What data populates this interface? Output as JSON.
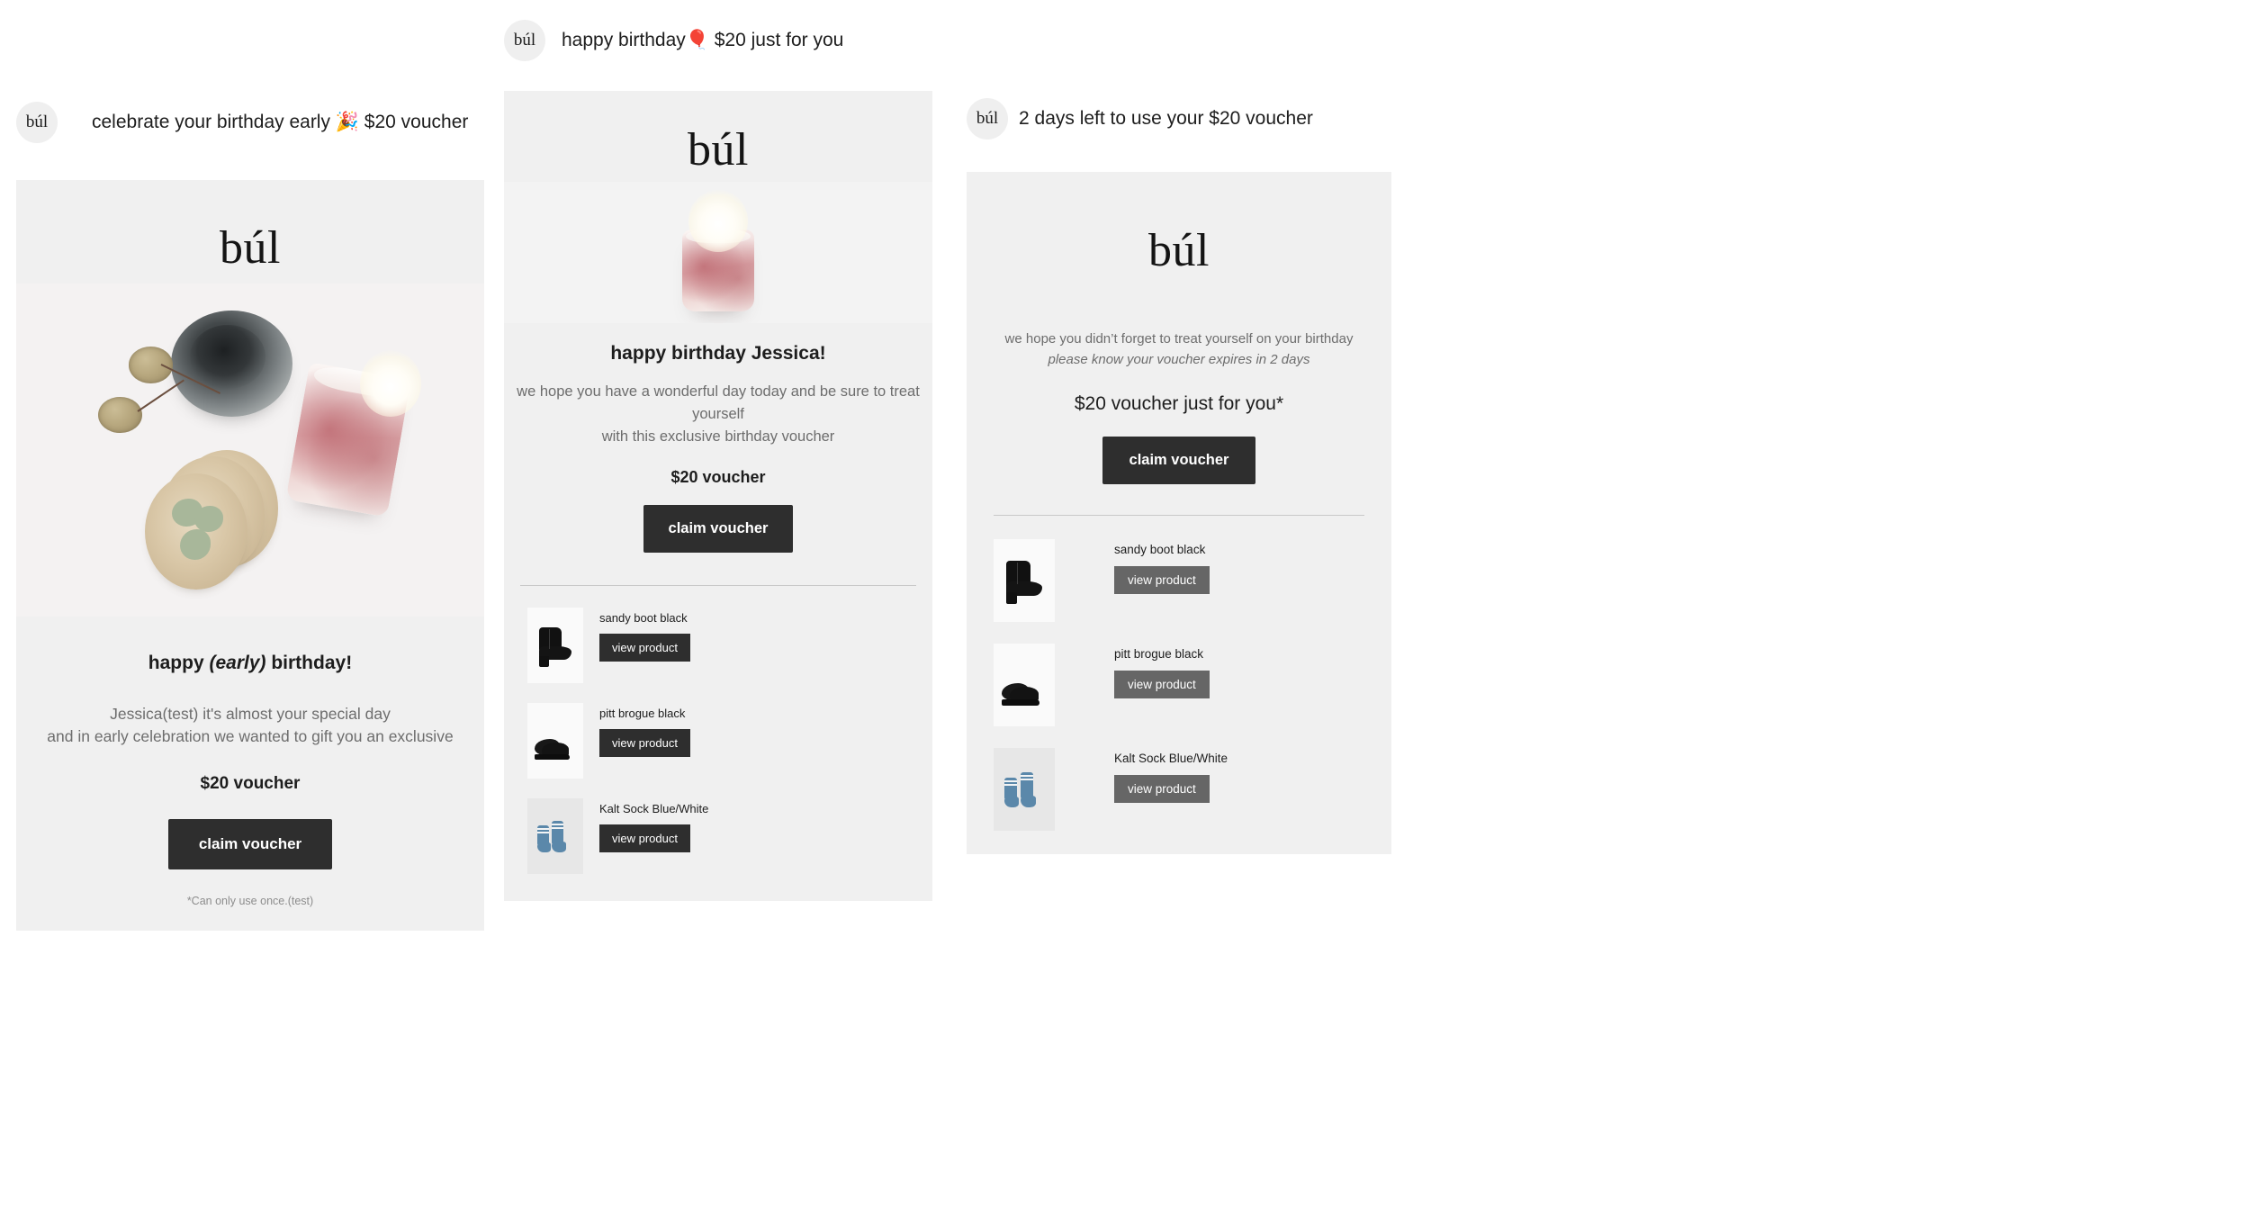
{
  "brand": {
    "logo": "búl",
    "avatar_logo": "búl"
  },
  "colors": {
    "card_bg": "#f0f0f0",
    "page_bg": "#ffffff",
    "cta_dark": "#2e2e2e",
    "cta_grey": "#666666",
    "heading": "#1d1d1d",
    "body_text": "#6d6d6d",
    "footnote": "#8d8d8d",
    "divider": "#c9c9c9",
    "avatar_bg": "#efefef"
  },
  "emails": [
    {
      "id": "early-birthday",
      "subject": "celebrate your birthday early 🎉 $20 voucher",
      "logo": "búl",
      "hero": "candle-still-life",
      "headline_prefix": "happy ",
      "headline_em": "(early)",
      "headline_suffix": " birthday!",
      "body_line1": "Jessica(test) it's almost your special day",
      "body_line2": "and in early celebration we wanted to gift you an exclusive",
      "voucher": "$20 voucher",
      "cta": "claim voucher",
      "footnote": "*Can only use once.(test)",
      "products": []
    },
    {
      "id": "happy-birthday",
      "subject": "happy birthday🎈 $20 just for you",
      "logo": "búl",
      "hero": "lit-candle",
      "headline": "happy birthday Jessica!",
      "body_line1": "we hope you have a wonderful day today and be sure to treat yourself",
      "body_line2": "with this exclusive birthday voucher",
      "voucher": "$20 voucher",
      "cta": "claim voucher",
      "products": [
        {
          "name": "sandy boot black",
          "button": "view product",
          "art": "boot"
        },
        {
          "name": "pitt brogue black",
          "button": "view product",
          "art": "brogue"
        },
        {
          "name": "Kalt Sock Blue/White",
          "button": "view product",
          "art": "sock"
        }
      ]
    },
    {
      "id": "voucher-expiring",
      "subject": "2 days left to use your $20 voucher",
      "logo": "búl",
      "body_line1": "we hope you didn’t forget to treat yourself on your birthday",
      "body_line2_em": "please know your voucher expires in 2 days",
      "voucher": "$20 voucher just for you*",
      "cta": "claim voucher",
      "products": [
        {
          "name": "sandy boot black",
          "button": "view product",
          "art": "boot"
        },
        {
          "name": "pitt brogue black",
          "button": "view product",
          "art": "brogue"
        },
        {
          "name": "Kalt Sock Blue/White",
          "button": "view product",
          "art": "sock"
        }
      ]
    }
  ]
}
